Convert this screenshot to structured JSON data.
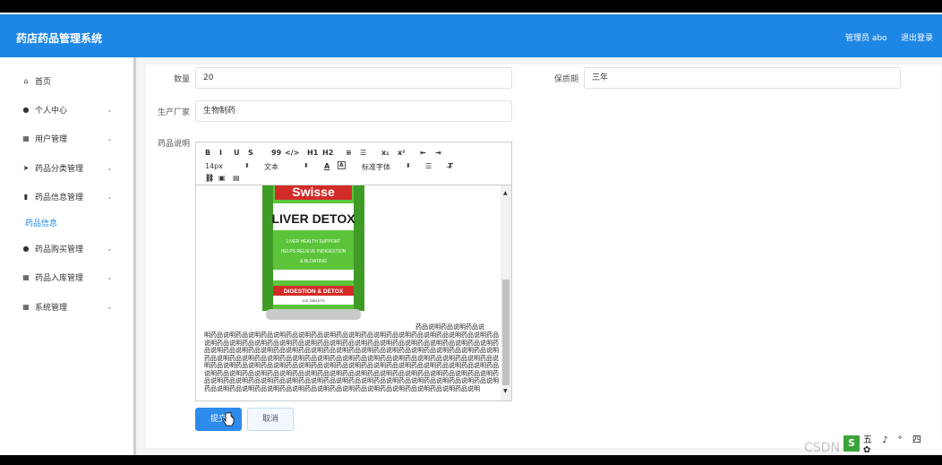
{
  "header": {
    "title": "药店药品管理系统",
    "user": "管理员 abo",
    "logout": "退出登录"
  },
  "sidebar": {
    "items": [
      {
        "label": "首页",
        "icon": "home-icon",
        "glyph": "⌂",
        "chevron": false
      },
      {
        "label": "个人中心",
        "icon": "user-icon",
        "glyph": "●",
        "chevron": true
      },
      {
        "label": "用户管理",
        "icon": "grid-icon",
        "glyph": "▦",
        "chevron": true
      },
      {
        "label": "药品分类管理",
        "icon": "send-icon",
        "glyph": "➤",
        "chevron": true
      },
      {
        "label": "药品信息管理",
        "icon": "document-icon",
        "glyph": "▮",
        "chevron": true
      },
      {
        "label": "药品信息",
        "icon": "",
        "glyph": "",
        "chevron": false,
        "sub": true
      },
      {
        "label": "药品购买管理",
        "icon": "user-icon",
        "glyph": "●",
        "chevron": true
      },
      {
        "label": "药品入库管理",
        "icon": "grid-icon",
        "glyph": "▦",
        "chevron": true
      },
      {
        "label": "系统管理",
        "icon": "grid-icon",
        "glyph": "▦",
        "chevron": true
      }
    ]
  },
  "form": {
    "quantity_label": "数量",
    "quantity_value": "20",
    "shelf_life_label": "保质期",
    "shelf_life_value": "三年",
    "manufacturer_label": "生产厂家",
    "manufacturer_value": "生物制药",
    "description_label": "药品说明"
  },
  "editor": {
    "toolbar_row1": [
      "B",
      "I",
      "U",
      "S",
      "99",
      "</>",
      "H1",
      "H2",
      "≡",
      "☰",
      "x₁",
      "x²",
      "⇤",
      "⇥"
    ],
    "font_size": "14px",
    "text_style": "文本",
    "font_family": "标准字体",
    "product": {
      "brand": "Swisse",
      "name": "LIVER DETOX",
      "line1": "LIVER HEALTH SUPPORT",
      "line2": "HELPS RELIEVE INDIGESTION",
      "line3": "& BLOATING",
      "band": "DIGESTION & DETOX",
      "count": "120 TABLETS"
    },
    "desc_first_line": "药品说明药品说明药品说",
    "desc_body": "明药品说明药品说明药品说明药品说明药品说明药品说明药品说明药品说明药品说明药品说明药品说明药品说明药品说明药品说明药品说明药品说明药品说明药品说明药品说明药品说明药品说明药品说明药品说明药品说明药品说明药品说明药品说明药品说明药品说明药品说明药品说明药品说明药品说明药品说明药品说明药品说明药品说明药品说明药品说明药品说明药品说明药品说明药品说明药品说明药品说明药品说明药品说明药品说明药品说明药品说明药品说明药品说明药品说明药品说明药品说明药品说明药品说明药品说明药品说明药品说明药品说明药品说明药品说明药品说明药品说明药品说明药品说明药品说明药品说明药品说明药品说明药品说明药品说明药品说明药品说明药品说明药品说明药品说明药品说明药品说明药品说明药品说明药品说明药品说明药品说明药品说明药品说明药品说明药品说明药品说明药品说明药品说明药品说明"
  },
  "buttons": {
    "submit": "提交",
    "cancel": "取消"
  },
  "overlay": {
    "watermark": "CSDN @x3029",
    "ime": "五 ♪ ° 四 ✿"
  }
}
